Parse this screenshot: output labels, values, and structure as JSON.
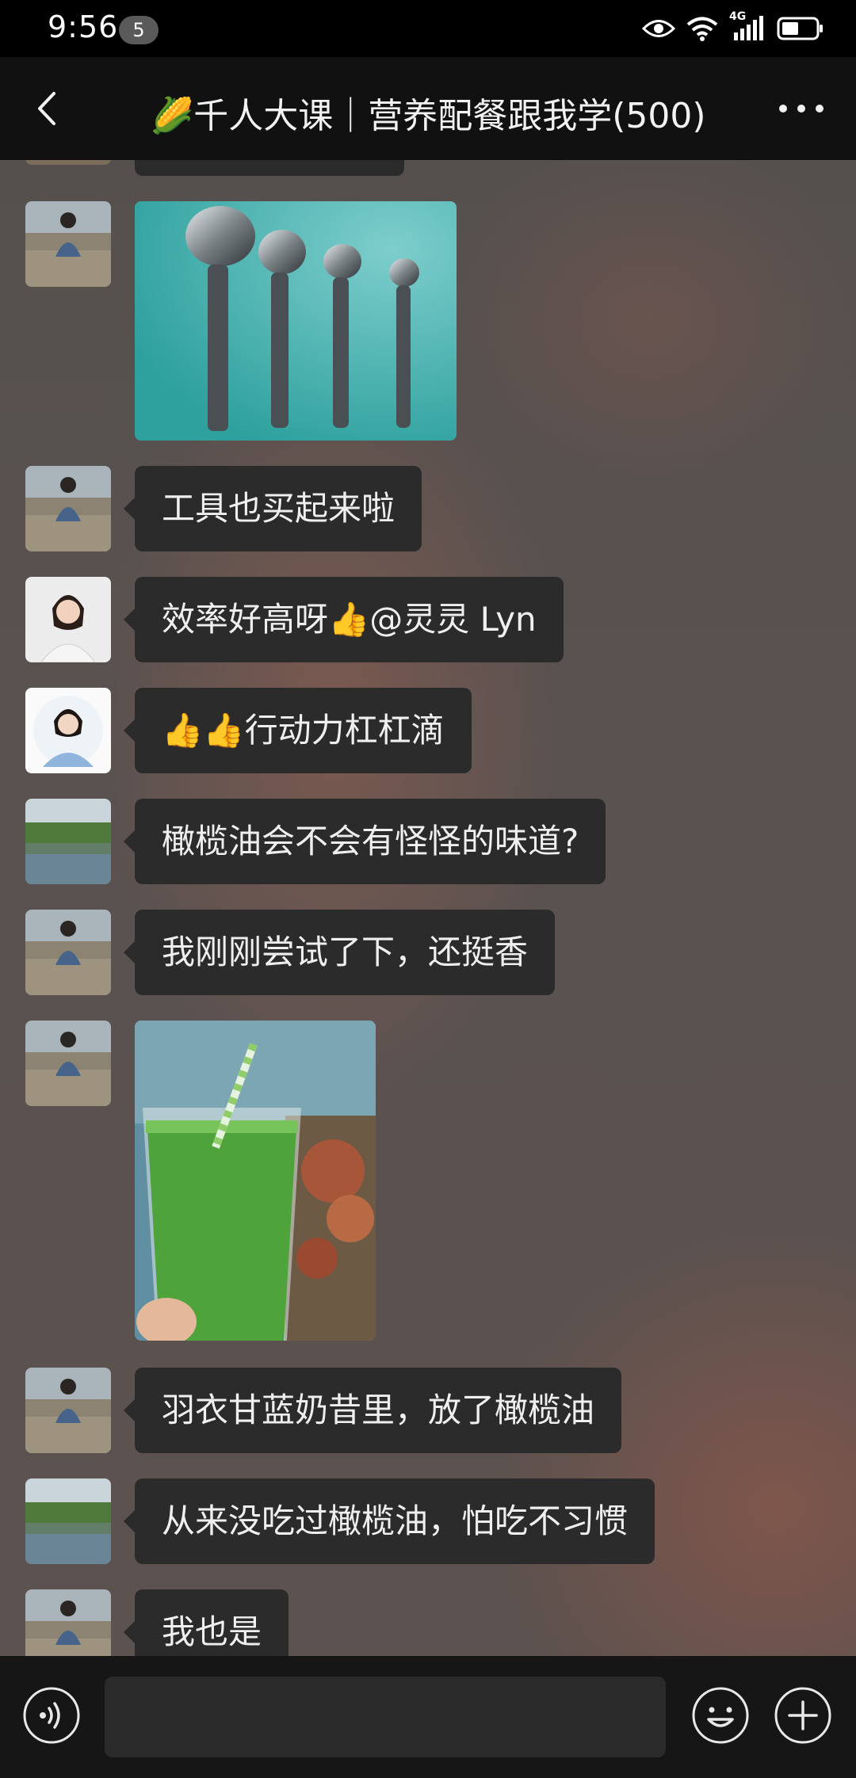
{
  "status_bar": {
    "time": "9:56",
    "notification_count": "5",
    "network": "4G"
  },
  "header": {
    "title": "🌽千人大课｜营养配餐跟我学(500)",
    "back_icon": "chevron-left-icon",
    "more_icon": "more-dots-icon"
  },
  "messages": [
    {
      "type": "text",
      "text": "工具也买起来啦"
    },
    {
      "type": "text",
      "text": "效率好高呀👍@灵灵 Lyn"
    },
    {
      "type": "text",
      "text": "👍👍行动力杠杠滴"
    },
    {
      "type": "text",
      "text": "橄榄油会不会有怪怪的味道?"
    },
    {
      "type": "text",
      "text": "我刚刚尝试了下，还挺香"
    },
    {
      "type": "text",
      "text": "羽衣甘蓝奶昔里，放了橄榄油"
    },
    {
      "type": "text",
      "text": "从来没吃过橄榄油，怕吃不习惯"
    },
    {
      "type": "text",
      "text": "我也是"
    }
  ],
  "images": {
    "spoons": "measuring spoons photo",
    "smoothie": "green smoothie photo"
  },
  "input_bar": {
    "voice_icon": "voice-icon",
    "emoji_icon": "emoji-icon",
    "plus_icon": "plus-circle-icon"
  },
  "colors": {
    "bubble": "#2b2b2b",
    "bar": "#111111"
  }
}
